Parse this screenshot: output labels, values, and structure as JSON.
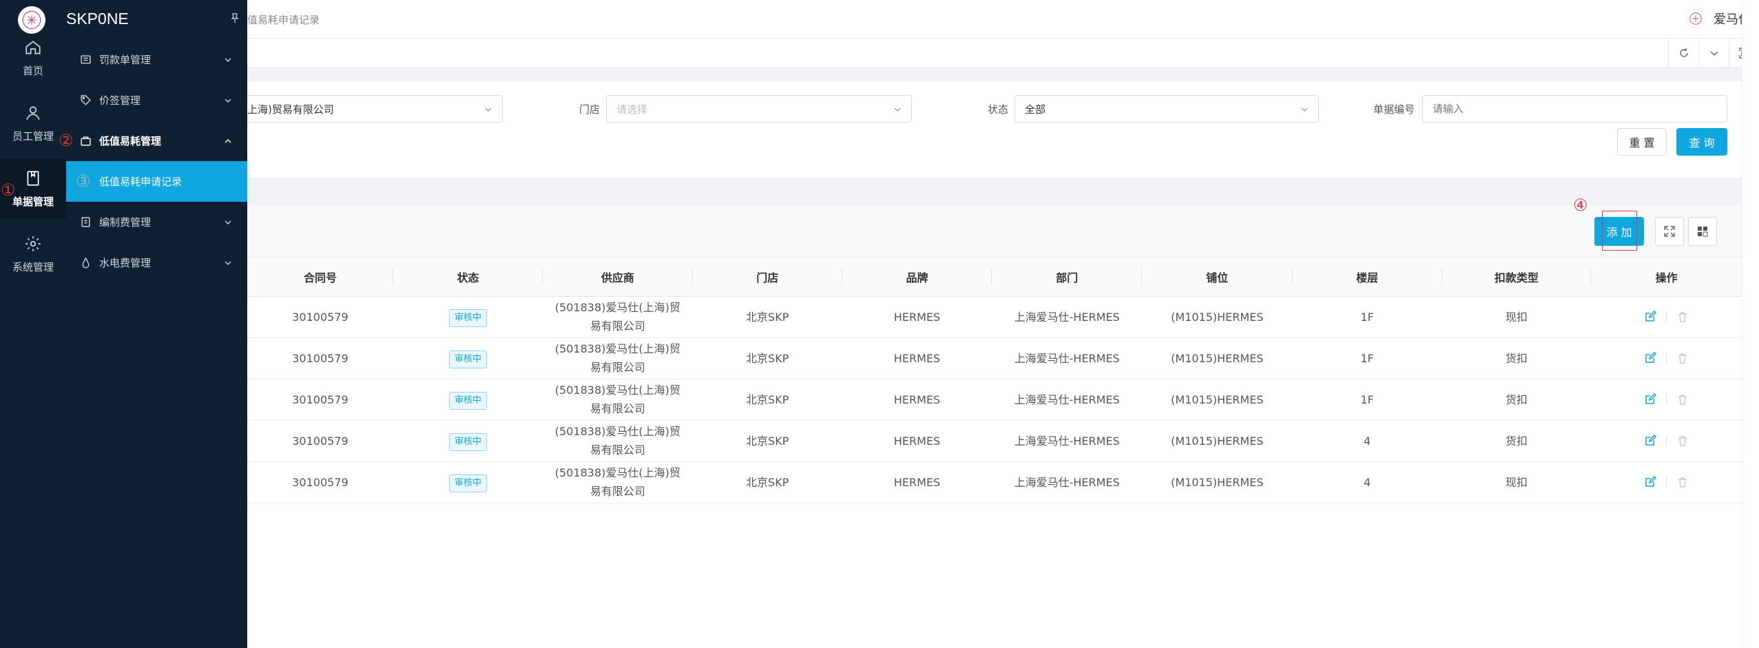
{
  "app": {
    "brand": "SKP0NE"
  },
  "rail": {
    "items": [
      {
        "label": "首页",
        "icon": "home-icon"
      },
      {
        "label": "员工管理",
        "icon": "user-icon"
      },
      {
        "label": "单据管理",
        "icon": "document-icon"
      },
      {
        "label": "系统管理",
        "icon": "gear-icon"
      }
    ]
  },
  "markers": {
    "m1": "①",
    "m2": "②",
    "m3": "③",
    "m4": "④"
  },
  "panel": {
    "items": [
      {
        "label": "罚款单管理"
      },
      {
        "label": "价签管理"
      },
      {
        "label": "低值易耗管理"
      },
      {
        "label": "低值易耗申请记录"
      },
      {
        "label": "编制费管理"
      },
      {
        "label": "水电费管理"
      }
    ]
  },
  "topbar": {
    "breadcrumb": "值易耗申请记录",
    "user_name": "爱马仕"
  },
  "filter": {
    "supplier_value": "上海)贸易有限公司",
    "store_label": "门店",
    "store_placeholder": "请选择",
    "status_label": "状态",
    "status_value": "全部",
    "docno_label": "单据编号",
    "docno_placeholder": "请输入",
    "reset_label": "重 置",
    "query_label": "查 询"
  },
  "toolbar": {
    "add_label": "添 加"
  },
  "table": {
    "columns": [
      "合同号",
      "状态",
      "供应商",
      "门店",
      "品牌",
      "部门",
      "铺位",
      "楼层",
      "扣款类型",
      "操作"
    ],
    "rows": [
      {
        "contract": "30100579",
        "status": "审核中",
        "supplier_l1": "(501838)爱马仕(上海)贸",
        "supplier_l2": "易有限公司",
        "store": "北京SKP",
        "brand": "HERMES",
        "dept": "上海爱马仕-HERMES",
        "booth": "(M1015)HERMES",
        "floor": "1F",
        "deduct": "现扣"
      },
      {
        "contract": "30100579",
        "status": "审核中",
        "supplier_l1": "(501838)爱马仕(上海)贸",
        "supplier_l2": "易有限公司",
        "store": "北京SKP",
        "brand": "HERMES",
        "dept": "上海爱马仕-HERMES",
        "booth": "(M1015)HERMES",
        "floor": "1F",
        "deduct": "货扣"
      },
      {
        "contract": "30100579",
        "status": "审核中",
        "supplier_l1": "(501838)爱马仕(上海)贸",
        "supplier_l2": "易有限公司",
        "store": "北京SKP",
        "brand": "HERMES",
        "dept": "上海爱马仕-HERMES",
        "booth": "(M1015)HERMES",
        "floor": "1F",
        "deduct": "货扣"
      },
      {
        "contract": "30100579",
        "status": "审核中",
        "supplier_l1": "(501838)爱马仕(上海)贸",
        "supplier_l2": "易有限公司",
        "store": "北京SKP",
        "brand": "HERMES",
        "dept": "上海爱马仕-HERMES",
        "booth": "(M1015)HERMES",
        "floor": "4",
        "deduct": "货扣"
      },
      {
        "contract": "30100579",
        "status": "审核中",
        "supplier_l1": "(501838)爱马仕(上海)贸",
        "supplier_l2": "易有限公司",
        "store": "北京SKP",
        "brand": "HERMES",
        "dept": "上海爱马仕-HERMES",
        "booth": "(M1015)HERMES",
        "floor": "4",
        "deduct": "现扣"
      }
    ]
  },
  "colors": {
    "accent": "#10a6df",
    "sidebar": "#0f2033",
    "marker": "#d9363e"
  }
}
